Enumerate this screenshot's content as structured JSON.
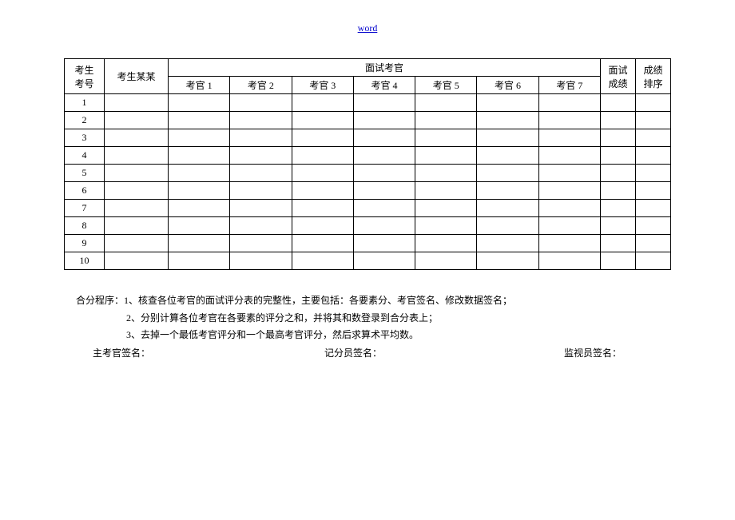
{
  "header": {
    "link_text": "word"
  },
  "table": {
    "headers": {
      "exam_id": "考生\n考号",
      "exam_name": "考生某某",
      "judge_group": "面试考官",
      "judges": [
        "考官 1",
        "考官 2",
        "考官 3",
        "考官 4",
        "考官 5",
        "考官 6",
        "考官 7"
      ],
      "score": "面试\n成绩",
      "rank": "成绩\n排序"
    },
    "rows": [
      {
        "id": "1"
      },
      {
        "id": "2"
      },
      {
        "id": "3"
      },
      {
        "id": "4"
      },
      {
        "id": "5"
      },
      {
        "id": "6"
      },
      {
        "id": "7"
      },
      {
        "id": "8"
      },
      {
        "id": "9"
      },
      {
        "id": "10"
      }
    ]
  },
  "notes": {
    "label": "合分程序：",
    "items": [
      "1、核查各位考官的面试评分表的完整性，主要包括：各要素分、考官签名、修改数据签名；",
      "2、分别计算各位考官在各要素的评分之和，并将其和数登录到合分表上；",
      "3、去掉一个最低考官评分和一个最高考官评分，然后求算术平均数。"
    ]
  },
  "signatures": {
    "chief": "主考官签名：",
    "scorer": "记分员签名：",
    "monitor": "监视员签名："
  }
}
